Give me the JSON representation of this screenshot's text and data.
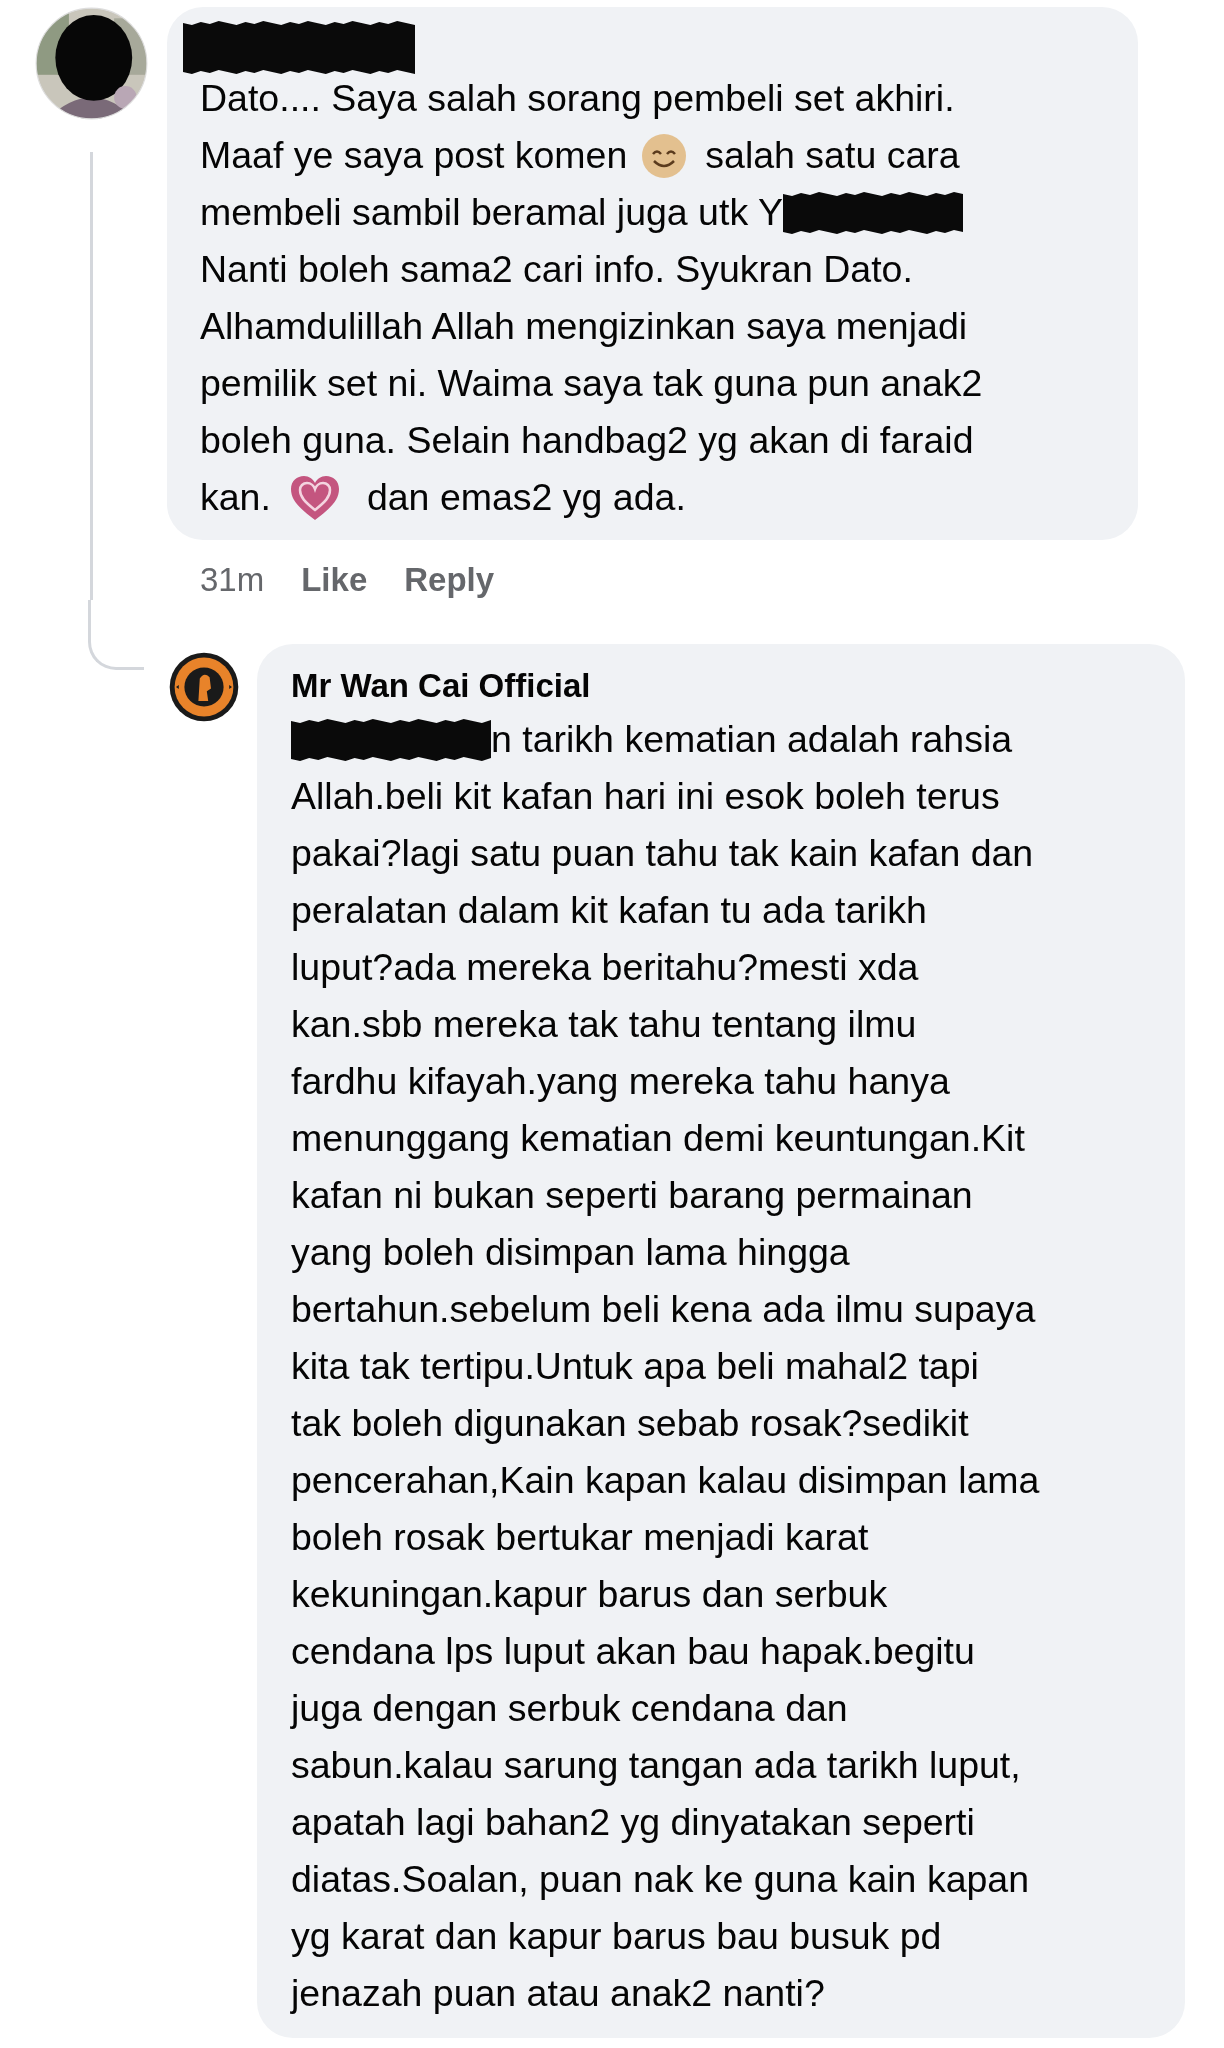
{
  "comments": [
    {
      "avatar": {
        "kind": "picture"
      },
      "author": [
        {
          "kind": "redaction"
        }
      ],
      "lines": [
        "Dato.... Saya salah sorang pembeli set akhiri.",
        [
          {
            "kind": "text",
            "text": "Maaf ye saya post komen"
          },
          {
            "kind": "smiley"
          },
          {
            "kind": "text",
            "text": "salah satu cara"
          }
        ],
        [
          {
            "kind": "text",
            "text": "membeli sambil beramal juga utk Y"
          },
          {
            "kind": "redaction"
          }
        ],
        "Nanti boleh sama2 cari info. Syukran Dato.",
        "Alhamdulillah Allah mengizinkan saya menjadi",
        "pemilik set ni. Waima saya tak guna pun anak2",
        "boleh guna. Selain handbag2 yg akan di faraid",
        [
          {
            "kind": "text",
            "text": "kan."
          },
          {
            "kind": "heart"
          },
          {
            "kind": "text",
            "text": "dan emas2 yg ada."
          }
        ]
      ],
      "actions": [
        {
          "kind": "time",
          "label": "31m"
        },
        {
          "kind": "link",
          "label": "Like"
        },
        {
          "kind": "link",
          "label": "Reply"
        }
      ],
      "replies": [
        {
          "avatar": {
            "kind": "logo"
          },
          "author": [
            {
              "kind": "text",
              "text": "Mr Wan Cai Official"
            }
          ],
          "lines": [
            [
              {
                "kind": "redaction"
              },
              {
                "kind": "text",
                "text": "n tarikh kematian adalah rahsia"
              }
            ],
            "Allah.beli kit kafan hari ini esok boleh terus",
            "pakai?lagi satu puan tahu tak kain kafan dan",
            "peralatan dalam kit kafan tu ada tarikh",
            "luput?ada mereka beritahu?mesti xda",
            "kan.sbb mereka tak tahu tentang ilmu",
            "fardhu kifayah.yang mereka tahu hanya",
            "menunggang kematian demi keuntungan.Kit",
            "kafan ni bukan seperti barang permainan",
            "yang boleh disimpan lama hingga",
            "bertahun.sebelum beli kena ada ilmu supaya",
            "kita tak tertipu.Untuk apa beli mahal2 tapi",
            "tak boleh digunakan sebab rosak?sedikit",
            "pencerahan,Kain kapan kalau disimpan lama",
            "boleh rosak bertukar menjadi karat",
            "kekuningan.kapur barus dan serbuk",
            "cendana lps luput akan bau hapak.begitu",
            "juga dengan serbuk cendana dan",
            "sabun.kalau sarung tangan ada tarikh luput,",
            "apatah lagi bahan2 yg dinyatakan seperti",
            "diatas.Soalan, puan nak ke guna kain kapan",
            "yg karat dan kapur barus bau busuk pd",
            "jenazah puan atau anak2 nanti?"
          ]
        }
      ]
    }
  ]
}
